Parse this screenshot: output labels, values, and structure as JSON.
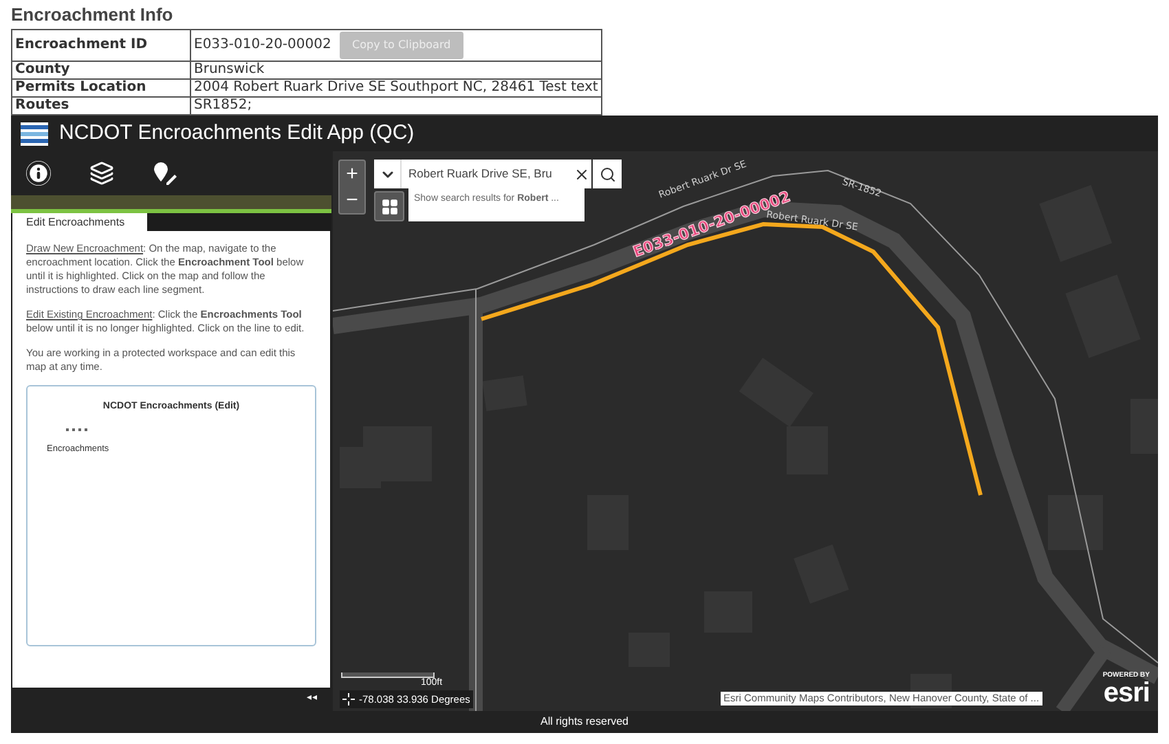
{
  "info": {
    "title": "Encroachment Info",
    "rows": [
      {
        "label": "Encroachment ID",
        "value": "E033-010-20-00002",
        "button": {
          "label": "Copy to Clipboard",
          "disabled": true
        }
      },
      {
        "label": "County",
        "value": "Brunswick"
      },
      {
        "label": "Permits Location",
        "value": "2004 Robert Ruark Drive SE Southport NC, 28461 Test text"
      },
      {
        "label": "Routes",
        "value": "SR1852;"
      }
    ]
  },
  "app": {
    "title": "NCDOT Encroachments Edit App (QC)",
    "toolbar": [
      {
        "kind": "info"
      },
      {
        "kind": "layers"
      },
      {
        "kind": "edit"
      }
    ],
    "tabs": [
      {
        "label": "Edit Encroachments",
        "selected": true
      }
    ],
    "paragraphs": [
      {
        "lead": "Draw New Encroachment",
        "text": ":  On the map, navigate to the encroachment location. Click the **Encroachment Tool** below until it is highlighted.  Click on the map and follow the instructions to draw each line segment."
      },
      {
        "lead": "Edit Existing Encroachment",
        "text": ":  Click the **Encroachments Tool** below until it is no longer highlighted.  Click on the line to edit."
      },
      {
        "text": "You are working in a protected workspace and can edit this map at any time."
      }
    ],
    "legend": {
      "title": "NCDOT Encroachments (Edit)",
      "items": [
        {
          "label": "Encroachments"
        }
      ]
    },
    "collapse": "◂◂",
    "footer": "All rights reserved"
  },
  "map": {
    "zoom_in": "+",
    "zoom_out": "−",
    "search": {
      "value": "Robert Ruark Drive SE, Bru",
      "suggestion": "Show search results for **Robert** ..."
    },
    "labels": [
      {
        "text": "Robert Ruark Dr SE",
        "kind": "road"
      },
      {
        "text": "SR-1852",
        "kind": "road"
      },
      {
        "text": "Robert Ruark Dr SE",
        "kind": "road"
      },
      {
        "text": "E033-010-20-00002",
        "kind": "feature"
      }
    ],
    "scale": "100ft",
    "coordinates": "-78.038 33.936 Degrees",
    "attribution": "Esri Community Maps Contributors, New Hanover County, State of ...",
    "logo": {
      "caption": "POWERED BY",
      "name": "esri"
    }
  }
}
